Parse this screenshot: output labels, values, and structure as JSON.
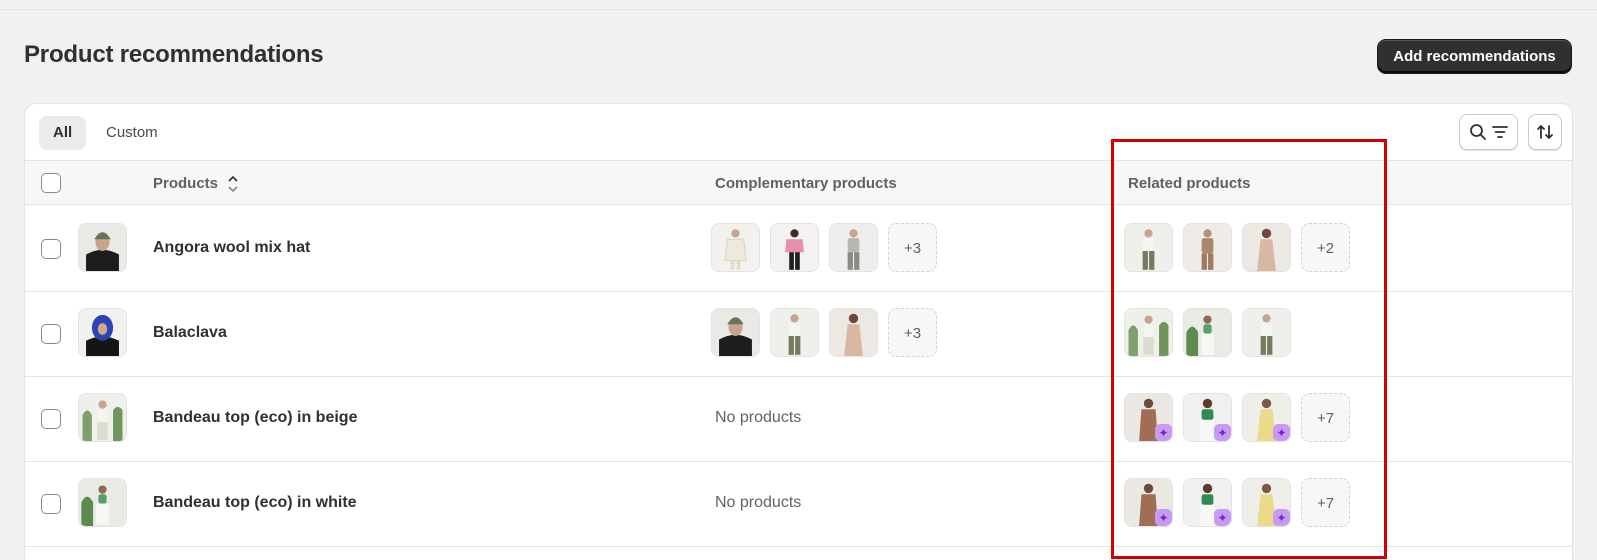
{
  "page": {
    "title": "Product recommendations",
    "add_button": "Add recommendations"
  },
  "tabs": [
    {
      "label": "All",
      "active": true
    },
    {
      "label": "Custom",
      "active": false
    }
  ],
  "toolbar": {
    "search_filter_icon": "search-filter-icon",
    "sort_icon": "sort-icon"
  },
  "columns": {
    "products": "Products",
    "complementary": "Complementary products",
    "related": "Related products"
  },
  "rows": [
    {
      "name": "Angora wool mix hat",
      "thumb": "dark-model-beanie",
      "complementary": {
        "items": [
          "white-coat",
          "pink-jacket",
          "grey-set"
        ],
        "more": "+3",
        "empty": ""
      },
      "related": {
        "items": [
          "olive-pants",
          "tan-suit",
          "nude-dress"
        ],
        "more": "+2",
        "ai": false
      }
    },
    {
      "name": "Balaclava",
      "thumb": "blue-balaclava",
      "complementary": {
        "items": [
          "dark-model-beanie",
          "olive-pants",
          "nude-dress"
        ],
        "more": "+3",
        "empty": ""
      },
      "related": {
        "items": [
          "white-outfit-plants",
          "white-outfit-green",
          "olive-pants"
        ],
        "more": "",
        "ai": false
      }
    },
    {
      "name": "Bandeau top (eco) in beige",
      "thumb": "white-outfit-plants",
      "complementary": {
        "items": [],
        "more": "",
        "empty": "No products"
      },
      "related": {
        "items": [
          "brown-dress",
          "green-top",
          "yellow-dress"
        ],
        "more": "+7",
        "ai": true
      }
    },
    {
      "name": "Bandeau top (eco) in white",
      "thumb": "white-outfit-green",
      "complementary": {
        "items": [],
        "more": "",
        "empty": "No products"
      },
      "related": {
        "items": [
          "brown-dress",
          "green-top",
          "yellow-dress"
        ],
        "more": "+7",
        "ai": true
      }
    }
  ],
  "ai_badge_icon": "sparkle-icon",
  "colors": {
    "primary_button": "#303030",
    "highlight": "#d40000",
    "ai_badge": "#c79bf2"
  }
}
